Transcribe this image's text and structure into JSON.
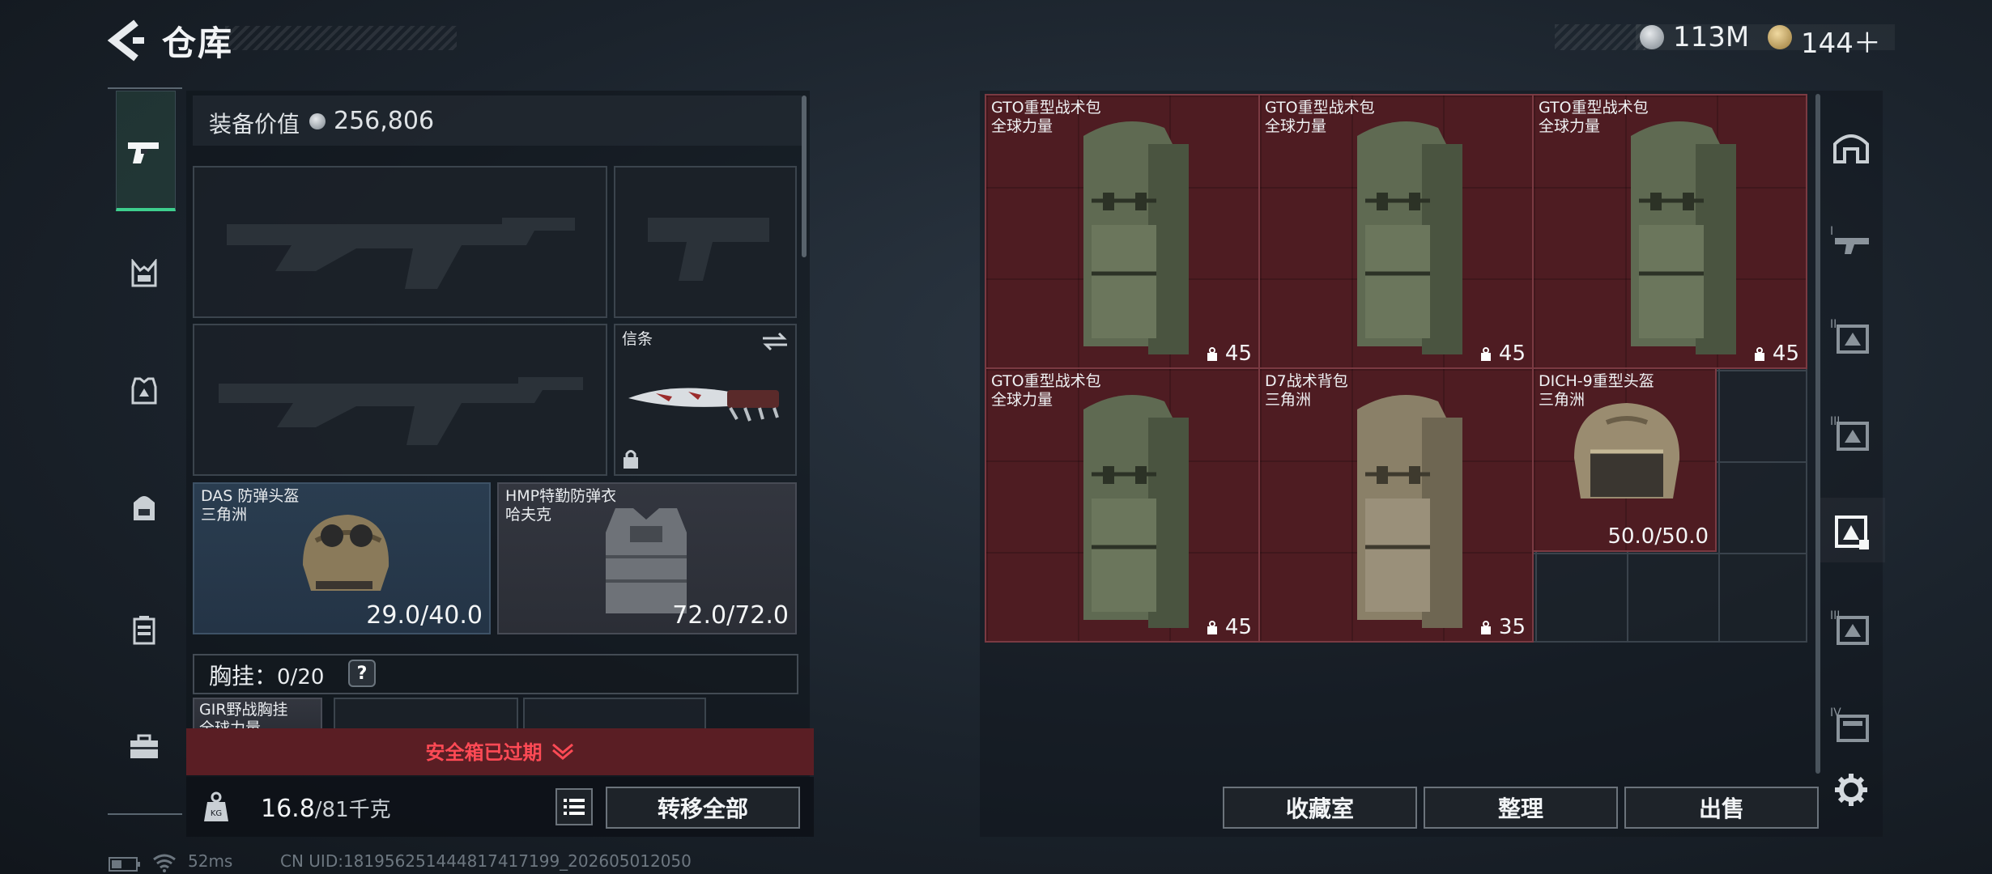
{
  "header": {
    "title": "仓库",
    "currency": [
      {
        "icon": "silver-coin-icon",
        "value": "113M"
      },
      {
        "icon": "gold-coin-icon",
        "value": "144＋"
      }
    ]
  },
  "sidebar": {
    "items": [
      {
        "icon": "pistol-icon",
        "active": true
      },
      {
        "icon": "chest-rig-icon"
      },
      {
        "icon": "armor-icon"
      },
      {
        "icon": "backpack-icon"
      },
      {
        "icon": "container-icon"
      },
      {
        "icon": "toolbox-icon"
      }
    ]
  },
  "equipment": {
    "value_label": "装备价值",
    "value": "256,806",
    "melee": {
      "name": "信条",
      "swap_icon": "swap-icon",
      "lock_icon": "lock-icon"
    },
    "helmet": {
      "name": "DAS 防弹头盔",
      "brand": "三角洲",
      "durability": "29.0/40.0"
    },
    "armor": {
      "name": "HMP特勤防弹衣",
      "brand": "哈夫克",
      "durability": "72.0/72.0"
    },
    "rig": {
      "label": "胸挂：",
      "count": "0/20",
      "help": "?"
    },
    "rig_item": {
      "name": "GIR野战胸挂",
      "brand": "全球力量"
    }
  },
  "safebox": {
    "text": "安全箱已过期"
  },
  "weight": {
    "current": "16.8",
    "max": "/81千克",
    "transfer_all": "转移全部"
  },
  "stash_items": [
    {
      "name": "GTO重型战术包",
      "brand": "全球力量",
      "value": "45"
    },
    {
      "name": "GTO重型战术包",
      "brand": "全球力量",
      "value": "45"
    },
    {
      "name": "GTO重型战术包",
      "brand": "全球力量",
      "value": "45"
    },
    {
      "name": "GTO重型战术包",
      "brand": "全球力量",
      "value": "45"
    },
    {
      "name": "D7战术背包",
      "brand": "三角洲",
      "value": "35"
    },
    {
      "name": "DICH-9重型头盔",
      "brand": "三角洲",
      "value": "50.0/50.0"
    }
  ],
  "actions": {
    "collection": "收藏室",
    "sort": "整理",
    "sell": "出售"
  },
  "status_bar": {
    "ping": "52ms",
    "uid": "CN UID:181956251444817417199_202605012050"
  },
  "colors": {
    "accent_green": "#3ecf8e",
    "alert_red": "#ff4a55",
    "item_bg": "#4e1c22"
  }
}
